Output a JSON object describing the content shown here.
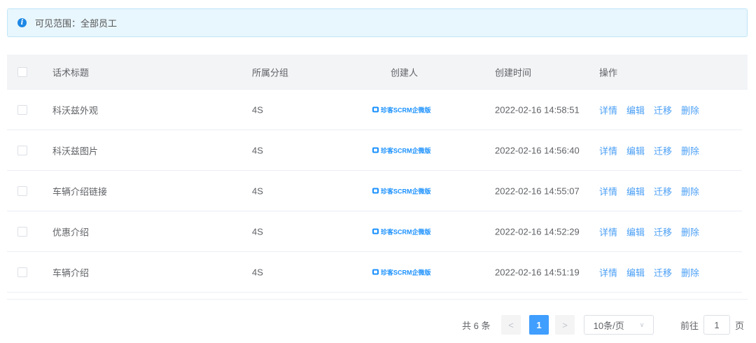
{
  "alert": {
    "text": "可见范围：全部员工"
  },
  "table": {
    "headers": [
      "话术标题",
      "所属分组",
      "创建人",
      "创建时间",
      "操作"
    ],
    "rows": [
      {
        "title": "科沃兹外观",
        "group": "4S",
        "creator": "珍客SCRM企微版",
        "time": "2022-02-16 14:58:51"
      },
      {
        "title": "科沃兹图片",
        "group": "4S",
        "creator": "珍客SCRM企微版",
        "time": "2022-02-16 14:56:40"
      },
      {
        "title": "车辆介绍链接",
        "group": "4S",
        "creator": "珍客SCRM企微版",
        "time": "2022-02-16 14:55:07"
      },
      {
        "title": "优惠介绍",
        "group": "4S",
        "creator": "珍客SCRM企微版",
        "time": "2022-02-16 14:52:29"
      },
      {
        "title": "车辆介绍",
        "group": "4S",
        "creator": "珍客SCRM企微版",
        "time": "2022-02-16 14:51:19"
      }
    ],
    "actions": [
      "详情",
      "编辑",
      "迁移",
      "删除"
    ]
  },
  "pagination": {
    "total": "共 6 条",
    "prev": "<",
    "page": "1",
    "next": ">",
    "page_size": "10条/页",
    "goto": "前往",
    "goto_value": "1",
    "page_unit": "页"
  }
}
